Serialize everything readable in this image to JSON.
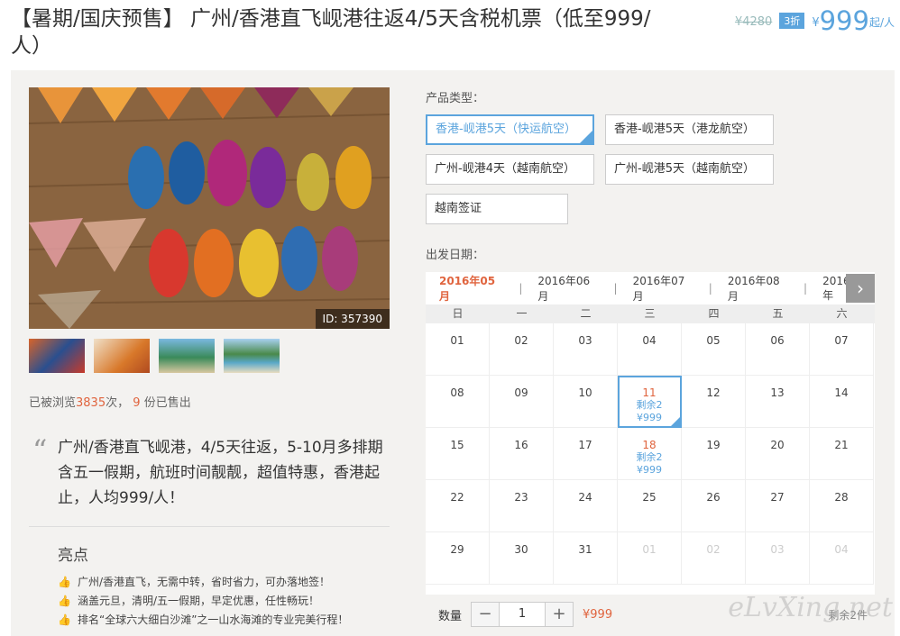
{
  "title": "【暑期/国庆预售】 广州/香港直飞岘港往返4/5天含税机票（低至999/人）",
  "price": {
    "original": "¥4280",
    "discount": "3折",
    "currency": "¥",
    "value": "999",
    "unit": "起/人"
  },
  "photo": {
    "id_label": "ID: 357390"
  },
  "stats": {
    "prefix": "已被浏览",
    "views": "3835",
    "mid": "次，",
    "sold": "9",
    "suffix": "份已售出"
  },
  "description": "广州/香港直飞岘港，4/5天往返，5-10月多排期含五一假期，航班时间靓靓，超值特惠，香港起止，人均999/人！",
  "highlights": {
    "title": "亮点",
    "items": [
      "广州/香港直飞，无需中转，省时省力，可办落地签！",
      "涵盖元旦，清明/五一假期，早定优惠，任性畅玩！",
      "排名“全球六大细白沙滩”之一山水海滩的专业完美行程！"
    ]
  },
  "product": {
    "label": "产品类型：",
    "options": [
      "香港-岘港5天（快运航空）",
      "香港-岘港5天（港龙航空）",
      "广州-岘港4天（越南航空）",
      "广州-岘港5天（越南航空）",
      "越南签证"
    ],
    "selected": 0
  },
  "departure": {
    "label": "出发日期："
  },
  "calendar": {
    "months": [
      "2016年05月",
      "2016年06月",
      "2016年07月",
      "2016年08月",
      "2016年"
    ],
    "weekdays": [
      "日",
      "一",
      "二",
      "三",
      "四",
      "五",
      "六"
    ],
    "cells": [
      {
        "d": "01"
      },
      {
        "d": "02"
      },
      {
        "d": "03"
      },
      {
        "d": "04"
      },
      {
        "d": "05"
      },
      {
        "d": "06"
      },
      {
        "d": "07"
      },
      {
        "d": "08"
      },
      {
        "d": "09"
      },
      {
        "d": "10"
      },
      {
        "d": "11",
        "s1": "剩余2",
        "s2": "¥999",
        "sel": true
      },
      {
        "d": "12"
      },
      {
        "d": "13"
      },
      {
        "d": "14"
      },
      {
        "d": "15"
      },
      {
        "d": "16"
      },
      {
        "d": "17"
      },
      {
        "d": "18",
        "s1": "剩余2",
        "s2": "¥999"
      },
      {
        "d": "19"
      },
      {
        "d": "20"
      },
      {
        "d": "21"
      },
      {
        "d": "22"
      },
      {
        "d": "23"
      },
      {
        "d": "24"
      },
      {
        "d": "25"
      },
      {
        "d": "26"
      },
      {
        "d": "27"
      },
      {
        "d": "28"
      },
      {
        "d": "29"
      },
      {
        "d": "30"
      },
      {
        "d": "31"
      },
      {
        "d": "01",
        "dim": true
      },
      {
        "d": "02",
        "dim": true
      },
      {
        "d": "03",
        "dim": true
      },
      {
        "d": "04",
        "dim": true
      }
    ]
  },
  "quantity": {
    "label": "数量",
    "value": "1",
    "minus": "−",
    "plus": "+",
    "price": "¥999",
    "remain": "剩余2件"
  },
  "watermark": "eLvXing.net",
  "colors": {
    "accent": "#5ba4dd",
    "highlight": "#e0643e"
  }
}
